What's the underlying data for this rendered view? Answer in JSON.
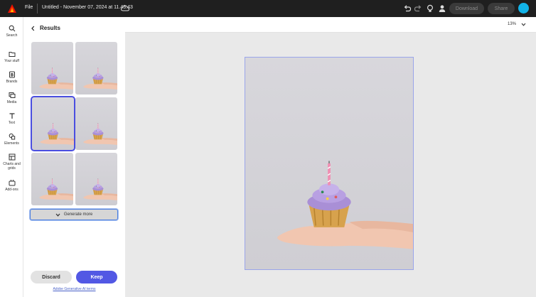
{
  "topbar": {
    "file_label": "File",
    "doc_title": "Untitled - November 07, 2024 at 11.43.43",
    "download_label": "Download",
    "share_label": "Share",
    "brand_color": "#eb1000",
    "accent_color": "#12b3e8"
  },
  "rail": {
    "items": [
      {
        "label": "Search",
        "icon": "search-icon"
      },
      {
        "label": "Your stuff",
        "icon": "folder-icon"
      },
      {
        "label": "Brands",
        "icon": "brand-icon"
      },
      {
        "label": "Media",
        "icon": "media-icon"
      },
      {
        "label": "Text",
        "icon": "text-icon"
      },
      {
        "label": "Elements",
        "icon": "shapes-icon"
      },
      {
        "label": "Charts and grids",
        "icon": "grid-icon"
      },
      {
        "label": "Add-ons",
        "icon": "addons-icon"
      }
    ]
  },
  "panel": {
    "title": "Results",
    "generate_more_label": "Generate more",
    "discard_label": "Discard",
    "keep_label": "Keep",
    "terms_label": "Adobe Generative AI terms",
    "selected_index": 2,
    "keep_color": "#5258e4"
  },
  "canvas": {
    "zoom_label": "13%"
  }
}
